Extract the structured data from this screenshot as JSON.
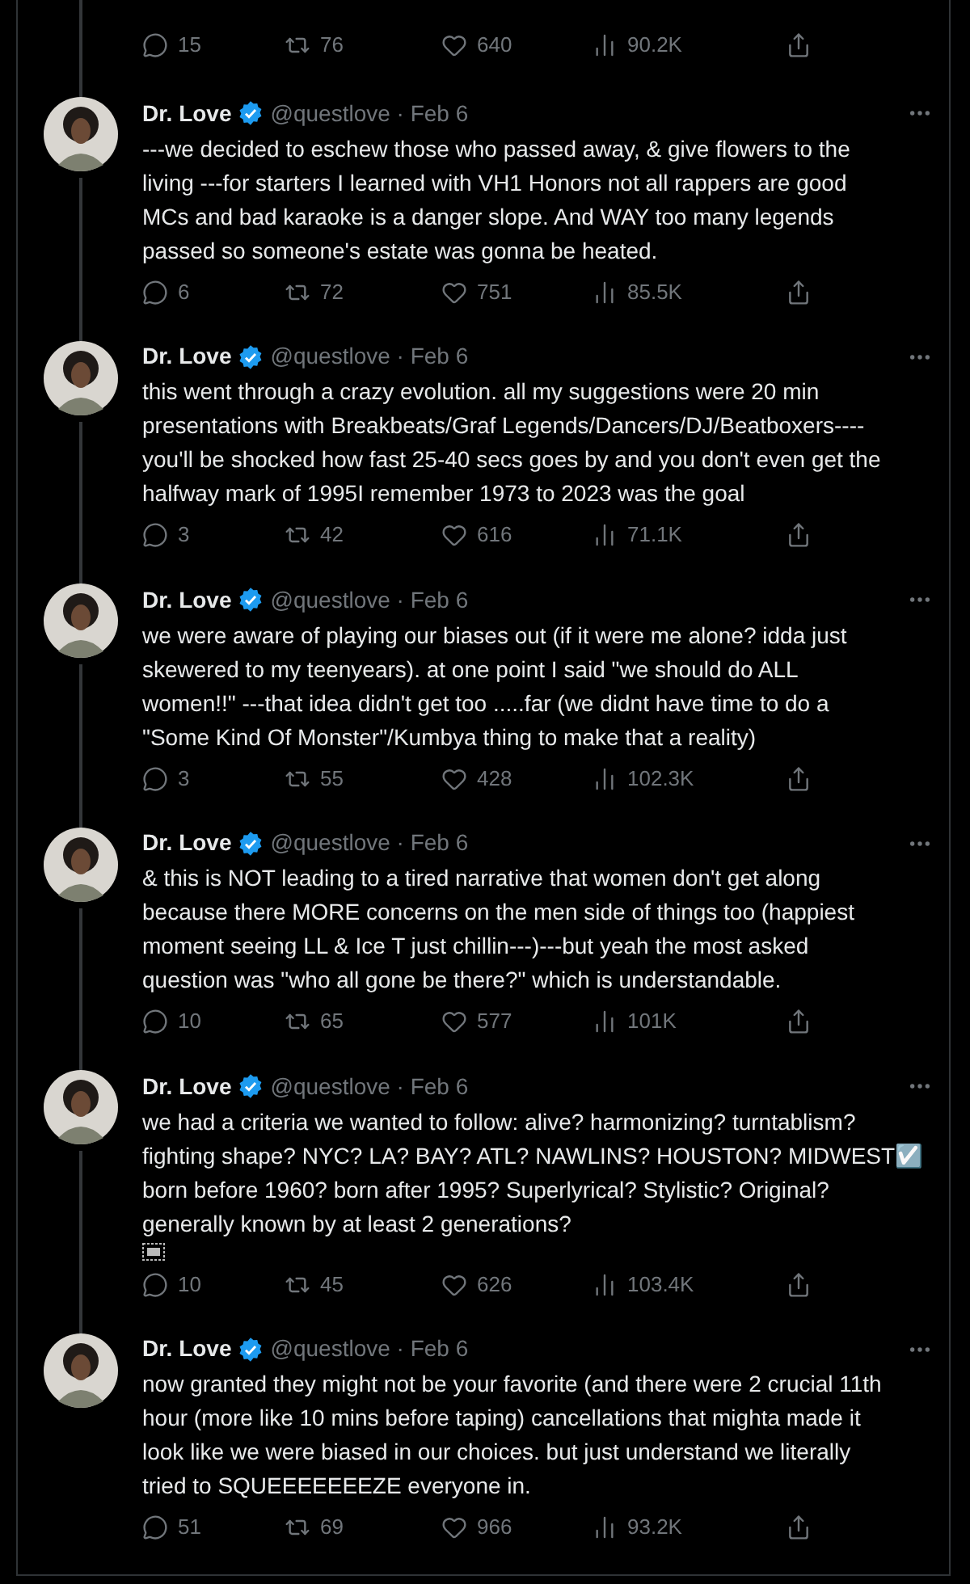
{
  "previous_tweet": {
    "stats": {
      "replies": "15",
      "retweets": "76",
      "likes": "640",
      "views": "90.2K"
    }
  },
  "tweets": [
    {
      "name": "Dr. Love",
      "verified": true,
      "meta": "@questlove · Feb 6",
      "text": "---we decided to eschew those who passed away, & give flowers to the\nliving ---for starters I learned with VH1 Honors not all rappers are good\nMCs and bad karaoke is a danger slope. And WAY too many legends\npassed so someone's estate was gonna be heated.",
      "object_glyph": false,
      "stats": {
        "replies": "6",
        "retweets": "72",
        "likes": "751",
        "views": "85.5K"
      }
    },
    {
      "name": "Dr. Love",
      "verified": true,
      "meta": "@questlove · Feb 6",
      "text": "this went through a crazy evolution. all my suggestions were 20 min\npresentations with Breakbeats/Graf Legends/Dancers/DJ/Beatboxers----\nyou'll be shocked how fast 25-40 secs goes by and you don't even get the\nhalfway mark of 1995I remember 1973 to 2023 was the goal",
      "object_glyph": false,
      "stats": {
        "replies": "3",
        "retweets": "42",
        "likes": "616",
        "views": "71.1K"
      }
    },
    {
      "name": "Dr. Love",
      "verified": true,
      "meta": "@questlove · Feb 6",
      "text": "we were aware of playing our biases out (if it were me alone? idda just\nskewered to my teenyears). at one point I said \"we should do ALL\nwomen!!\" ---that idea didn't get too .....far (we didnt have time to do a\n\"Some Kind Of Monster\"/Kumbya thing to make that a reality)",
      "object_glyph": false,
      "stats": {
        "replies": "3",
        "retweets": "55",
        "likes": "428",
        "views": "102.3K"
      }
    },
    {
      "name": "Dr. Love",
      "verified": true,
      "meta": "@questlove · Feb 6",
      "text": "& this is NOT leading to a tired narrative that women don't get along\nbecause there MORE concerns on the men side of things too (happiest\nmoment seeing LL  & Ice T just chillin---)---but yeah the most asked\nquestion was \"who all gone be there?\" which is understandable.",
      "object_glyph": false,
      "stats": {
        "replies": "10",
        "retweets": "65",
        "likes": "577",
        "views": "101K"
      }
    },
    {
      "name": "Dr. Love",
      "verified": true,
      "meta": "@questlove · Feb 6",
      "text": "we had a criteria we wanted to follow: alive? harmonizing? turntablism?\nfighting shape? NYC? LA? BAY? ATL? NAWLINS? HOUSTON? MIDWEST☑️\nborn before 1960? born after 1995? Superlyrical? Stylistic? Original?\ngenerally known by at least 2 generations?",
      "object_glyph": true,
      "stats": {
        "replies": "10",
        "retweets": "45",
        "likes": "626",
        "views": "103.4K"
      }
    },
    {
      "name": "Dr. Love",
      "verified": true,
      "meta": "@questlove · Feb 6",
      "text": "now granted they might not be your favorite (and there were 2 crucial 11th\nhour (more like 10 mins before taping) cancellations that mighta made it\nlook like we were biased in our choices. but just understand we literally\ntried to SQUEEEEEEEZE everyone in.",
      "object_glyph": false,
      "stats": {
        "replies": "51",
        "retweets": "69",
        "likes": "966",
        "views": "93.2K"
      }
    }
  ]
}
